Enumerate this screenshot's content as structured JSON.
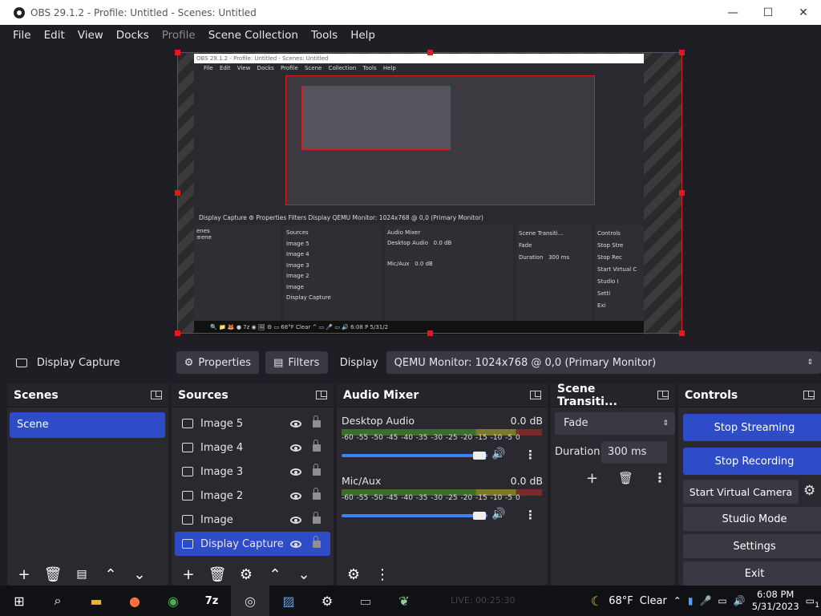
{
  "window": {
    "title": "OBS 29.1.2 - Profile: Untitled - Scenes: Untitled",
    "minimize": "—",
    "maximize": "☐",
    "close": "✕"
  },
  "menu": {
    "file": "File",
    "edit": "Edit",
    "view": "View",
    "docks": "Docks",
    "profile": "Profile",
    "scene_collection": "Scene Collection",
    "tools": "Tools",
    "help": "Help"
  },
  "preview": {
    "inner_title": "OBS 29.1.2 - Profile: Untitled - Scenes: Untitled",
    "inner_menu": "File Edit View Docks Profile Scene Collection Tools Help",
    "inner_row": "Display Capture      ⚙ Properties   Filters   Display   QEMU Monitor: 1024x768 @ 0,0 (Primary Monitor)",
    "inner_scenes": "enes\n≡ene",
    "inner_sources": "Sources\nImage 5\nImage 4\nImage 3\nImage 2\nImage\nDisplay Capture",
    "inner_audio": "Audio Mixer\nDesktop Audio   0.0 dB\n\nMic/Aux   0.0 dB",
    "inner_trans": "Scene Transiti...\nFade\nDuration   300 ms",
    "inner_controls": "Controls\nStop Stre\nStop Rec\nStart Virtual C\nStudio I\nSetti\nExi",
    "inner_task": "🔍   📁   🦊   ●   7z   ◉   🖼   ⚙   ▭        68°F  Clear   ^  ▭ 🎤 ▭ 🔊  6:08 P  5/31/2"
  },
  "context": {
    "source_name": "Display Capture",
    "properties": "Properties",
    "filters": "Filters",
    "display_label": "Display",
    "display_value": "QEMU Monitor: 1024x768 @ 0,0 (Primary Monitor)"
  },
  "scenes": {
    "title": "Scenes",
    "items": [
      "Scene"
    ]
  },
  "sources": {
    "title": "Sources",
    "items": [
      "Image 5",
      "Image 4",
      "Image 3",
      "Image 2",
      "Image",
      "Display Capture"
    ]
  },
  "audio": {
    "title": "Audio Mixer",
    "scale": "-60 -55 -50 -45 -40 -35 -30 -25 -20 -15 -10 -5 0",
    "channels": [
      {
        "name": "Desktop Audio",
        "db": "0.0 dB",
        "volume": 1.0
      },
      {
        "name": "Mic/Aux",
        "db": "0.0 dB",
        "volume": 1.0
      }
    ]
  },
  "transitions": {
    "title": "Scene Transiti...",
    "selected": "Fade",
    "duration_label": "Duration",
    "duration_value": "300 ms"
  },
  "controls": {
    "title": "Controls",
    "stop_streaming": "Stop Streaming",
    "stop_recording": "Stop Recording",
    "start_virtual_camera": "Start Virtual Camera",
    "studio_mode": "Studio Mode",
    "settings": "Settings",
    "exit": "Exit"
  },
  "taskbar": {
    "weather_temp": "68°F",
    "weather_text": "Clear",
    "time": "6:08 PM",
    "date": "5/31/2023",
    "notifications": "1",
    "ghost_text": "LIVE: 00:25:30"
  },
  "colors": {
    "accent": "#2e4cc8",
    "background": "#1f1e25",
    "dock": "#2a2930",
    "selection_red": "#e01b1b"
  }
}
